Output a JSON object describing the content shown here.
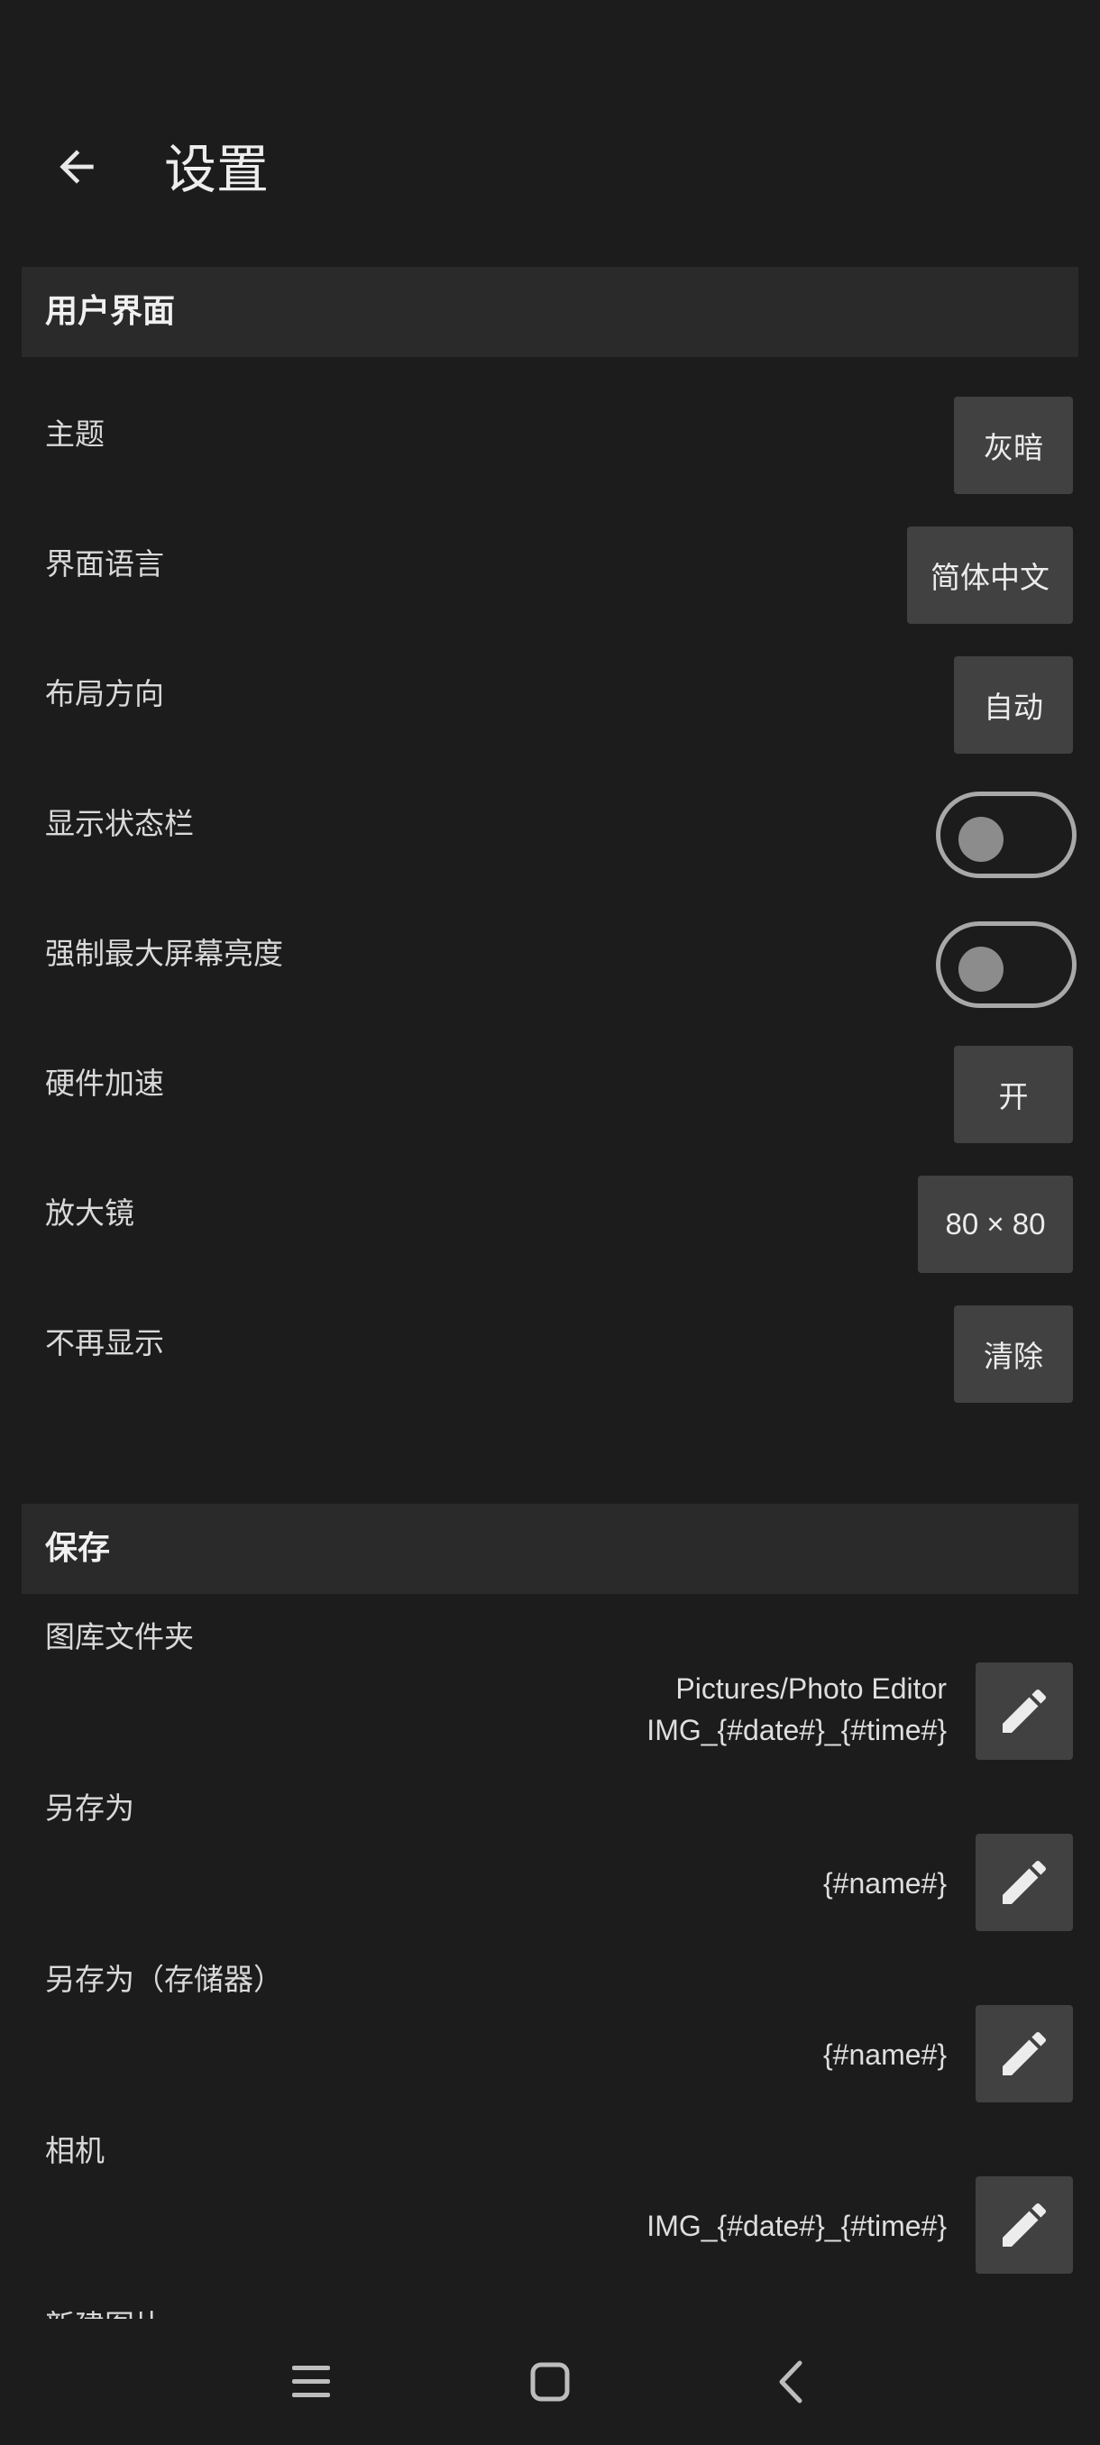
{
  "header": {
    "title": "设置",
    "back_icon": "arrow-left-icon"
  },
  "ui_section": {
    "title": "用户界面",
    "rows": [
      {
        "label": "主题",
        "value": "灰暗"
      },
      {
        "label": "界面语言",
        "value": "简体中文"
      },
      {
        "label": "布局方向",
        "value": "自动"
      },
      {
        "label": "显示状态栏",
        "toggle": false
      },
      {
        "label": "强制最大屏幕亮度",
        "toggle": false
      },
      {
        "label": "硬件加速",
        "value": "开"
      },
      {
        "label": "放大镜",
        "value": "80 × 80"
      },
      {
        "label": "不再显示",
        "value": "清除"
      }
    ]
  },
  "save_section": {
    "title": "保存",
    "rows": [
      {
        "label": "图库文件夹",
        "value_line1": "Pictures/Photo Editor",
        "value_line2": "IMG_{#date#}_{#time#}"
      },
      {
        "label": "另存为",
        "value_line1": "{#name#}"
      },
      {
        "label": "另存为（存储器）",
        "value_line1": "{#name#}"
      },
      {
        "label": "相机",
        "value_line1": "IMG_{#date#}_{#time#}"
      },
      {
        "label": "新建图片"
      }
    ]
  },
  "navbar": {
    "icons": [
      "menu-icon",
      "home-icon",
      "back-icon"
    ]
  },
  "colors": {
    "background": "#1c1c1c",
    "section_bg": "#2a2a2a",
    "button_bg": "#414141"
  }
}
